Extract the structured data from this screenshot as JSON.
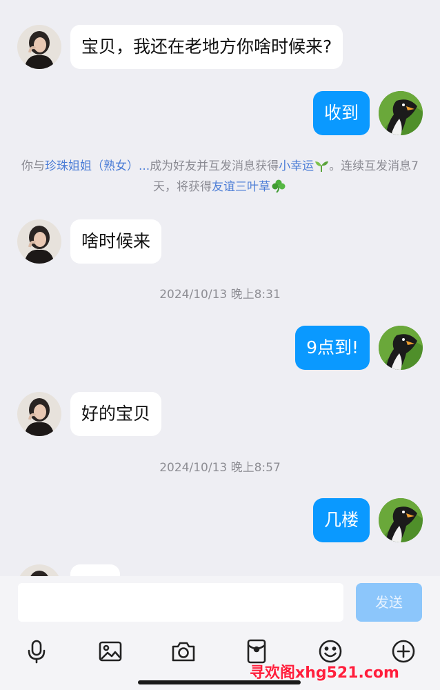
{
  "messages": [
    {
      "side": "left",
      "text": "宝贝，我还在老地方你啥时候来?"
    },
    {
      "side": "right",
      "text": "收到"
    },
    {
      "side": "left",
      "text": "啥时候来"
    },
    {
      "side": "right",
      "text": "9点到!"
    },
    {
      "side": "left",
      "text": "好的宝贝"
    },
    {
      "side": "right",
      "text": "几楼"
    }
  ],
  "system_note": {
    "prefix": "你与",
    "friend_name": "珍珠姐姐（熟女）...",
    "middle": "成为好友并互发消息获得",
    "reward1": "小幸运",
    "reward1_icon": "sprout-icon",
    "suffix1": "。连续互发消息7天，将获得",
    "reward2": "友谊三叶草",
    "reward2_icon": "clover-icon",
    "link_color": "#4c7dd6"
  },
  "timestamps": [
    "2024/10/13 晚上8:31",
    "2024/10/13 晚上8:57"
  ],
  "composer": {
    "input_value": "",
    "send_label": "发送"
  },
  "toolbar": [
    "microphone-icon",
    "image-icon",
    "camera-icon",
    "red-packet-icon",
    "emoji-icon",
    "plus-icon"
  ],
  "watermark": "寻欢阁xhg521.com",
  "colors": {
    "background": "#eeeef3",
    "outgoing_bubble": "#0a99ff",
    "incoming_bubble": "#ffffff",
    "send_button": "#8cc6fb",
    "watermark": "#ff1e3c"
  }
}
